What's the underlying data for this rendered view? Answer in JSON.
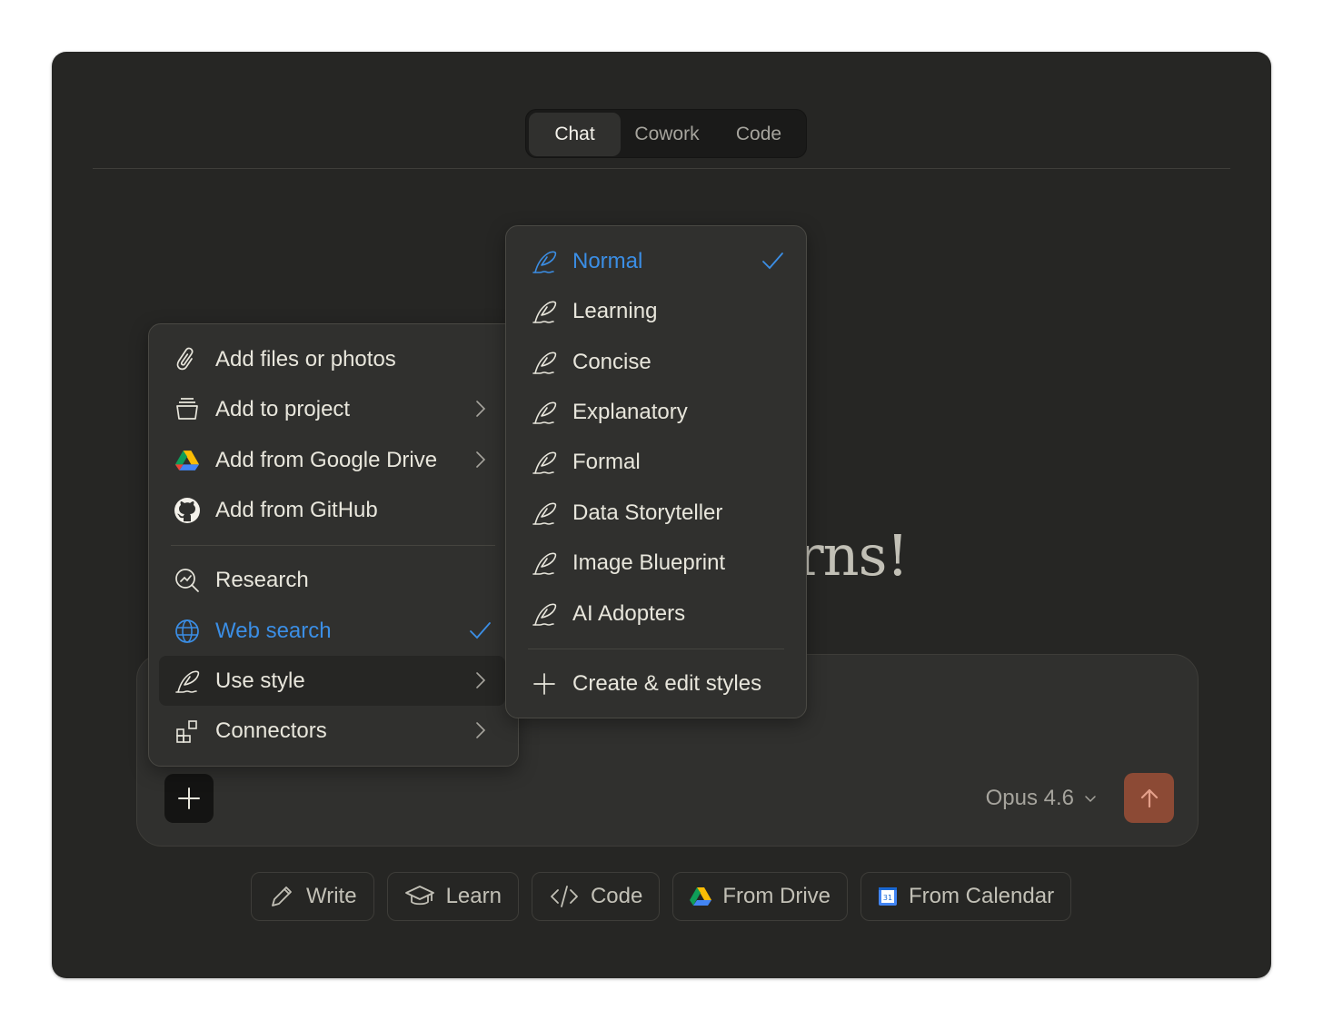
{
  "tabs": [
    {
      "label": "Chat",
      "active": true
    },
    {
      "label": "Cowork",
      "active": false
    },
    {
      "label": "Code",
      "active": false
    }
  ],
  "greeting_partial": "rns!",
  "composer": {
    "model": "Opus 4.6",
    "send_color": "#8c4a35"
  },
  "chips": [
    {
      "label": "Write",
      "icon": "pencil-icon"
    },
    {
      "label": "Learn",
      "icon": "graduation-cap-icon"
    },
    {
      "label": "Code",
      "icon": "code-icon"
    },
    {
      "label": "From Drive",
      "icon": "google-drive-icon"
    },
    {
      "label": "From Calendar",
      "icon": "google-calendar-icon"
    }
  ],
  "attach_menu": {
    "items": [
      {
        "label": "Add files or photos",
        "icon": "paperclip-icon",
        "submenu": false
      },
      {
        "label": "Add to project",
        "icon": "project-box-icon",
        "submenu": true
      },
      {
        "label": "Add from Google Drive",
        "icon": "google-drive-icon",
        "submenu": true
      },
      {
        "label": "Add from GitHub",
        "icon": "github-icon",
        "submenu": false
      },
      {
        "label": "Research",
        "icon": "research-icon",
        "submenu": false
      },
      {
        "label": "Web search",
        "icon": "globe-icon",
        "checked": true
      },
      {
        "label": "Use style",
        "icon": "feather-icon",
        "submenu": true,
        "highlighted": true
      },
      {
        "label": "Connectors",
        "icon": "connectors-icon",
        "submenu": true
      }
    ]
  },
  "style_menu": {
    "items": [
      {
        "label": "Normal",
        "checked": true
      },
      {
        "label": "Learning"
      },
      {
        "label": "Concise"
      },
      {
        "label": "Explanatory"
      },
      {
        "label": "Formal"
      },
      {
        "label": "Data Storyteller"
      },
      {
        "label": "Image Blueprint"
      },
      {
        "label": "AI Adopters"
      }
    ],
    "create_label": "Create & edit styles"
  },
  "colors": {
    "accent_blue": "#3b8ee5",
    "window_bg": "#262624",
    "panel_bg": "#30302e"
  }
}
